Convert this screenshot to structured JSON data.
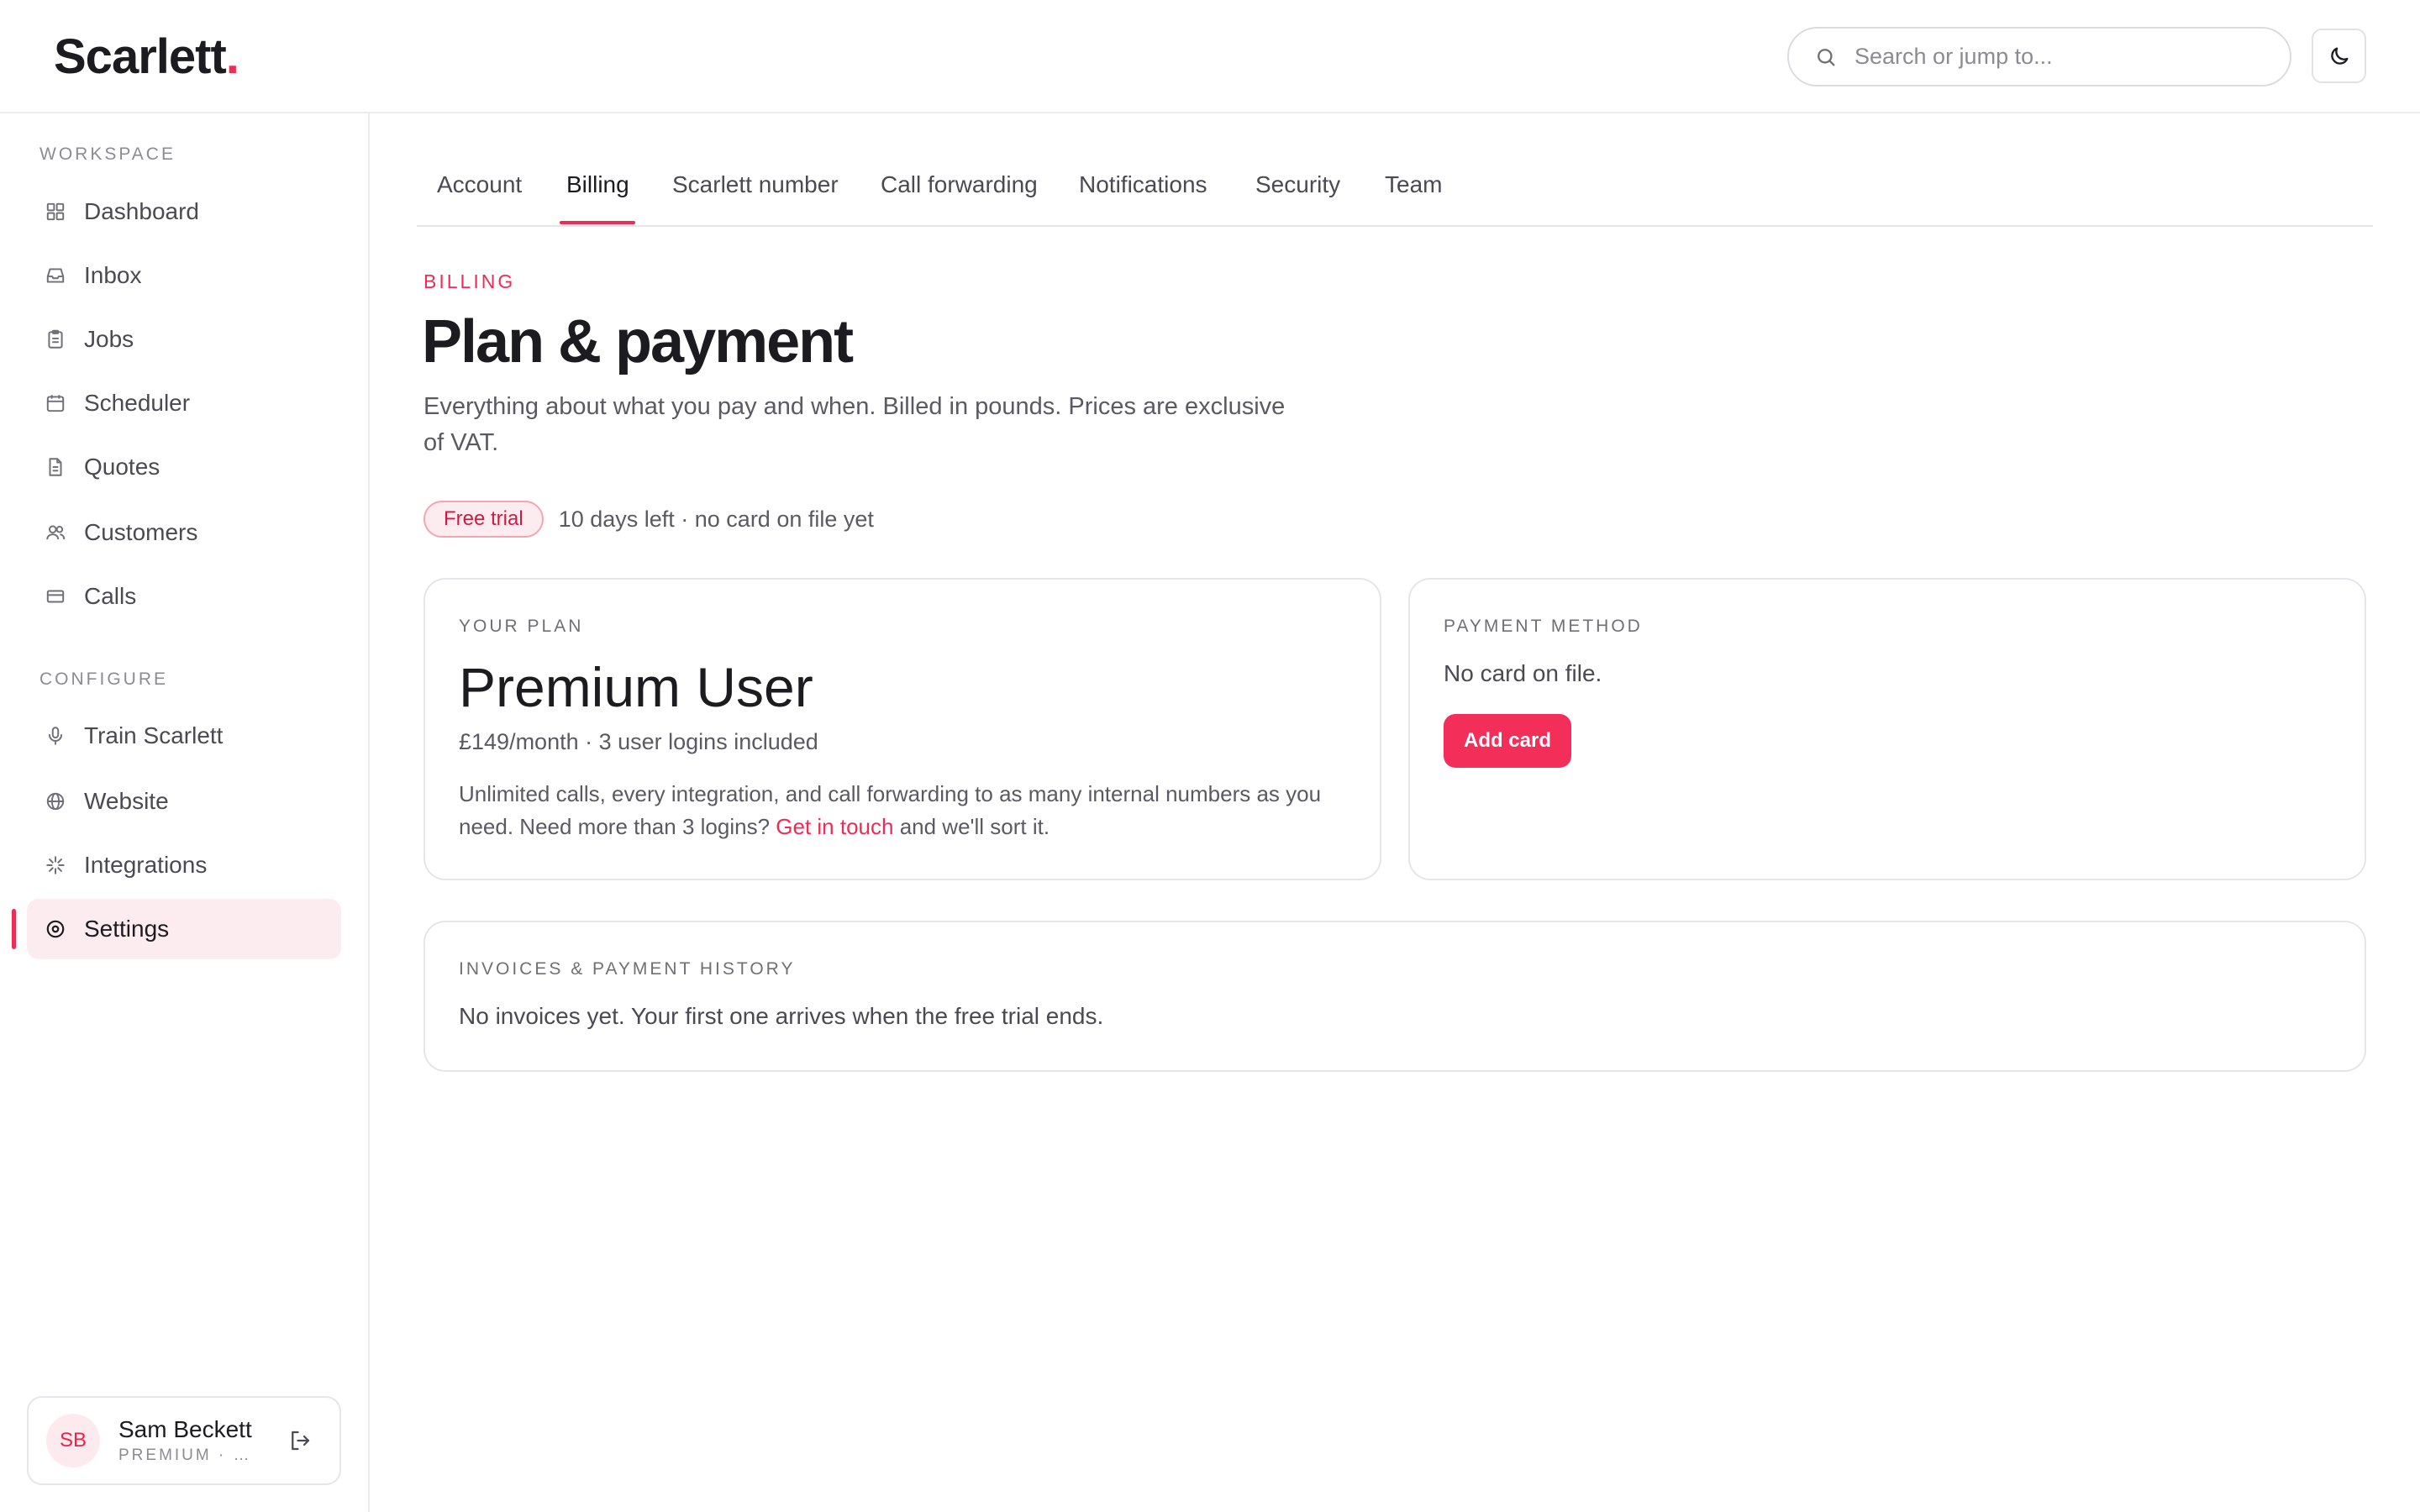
{
  "app": {
    "logo_text": "Scarlett",
    "logo_dot": ".",
    "brand_color": "#ee2c54"
  },
  "header": {
    "search_placeholder": "Search or jump to...",
    "search_icon": "search-icon",
    "theme_icon": "moon-icon"
  },
  "sidebar": {
    "workspace_label": "WORKSPACE",
    "workspace_items": [
      {
        "label": "Dashboard",
        "icon": "grid-icon"
      },
      {
        "label": "Inbox",
        "icon": "inbox-icon"
      },
      {
        "label": "Jobs",
        "icon": "clipboard-icon"
      },
      {
        "label": "Scheduler",
        "icon": "calendar-icon"
      },
      {
        "label": "Quotes",
        "icon": "document-icon"
      },
      {
        "label": "Customers",
        "icon": "users-icon"
      },
      {
        "label": "Calls",
        "icon": "card-icon"
      }
    ],
    "configure_label": "CONFIGURE",
    "configure_items": [
      {
        "label": "Train Scarlett",
        "icon": "microphone-icon"
      },
      {
        "label": "Website",
        "icon": "globe-icon"
      },
      {
        "label": "Integrations",
        "icon": "sparkle-icon"
      },
      {
        "label": "Settings",
        "icon": "settings-icon",
        "active": true
      }
    ],
    "user": {
      "initials": "SB",
      "name": "Sam Beckett",
      "plan": "PREMIUM · S..."
    }
  },
  "tabs": [
    {
      "label": "Account"
    },
    {
      "label": "Billing",
      "active": true
    },
    {
      "label": "Scarlett number"
    },
    {
      "label": "Call forwarding"
    },
    {
      "label": "Notifications"
    },
    {
      "label": "Security"
    },
    {
      "label": "Team"
    }
  ],
  "billing": {
    "eyebrow": "BILLING",
    "title": "Plan & payment",
    "description": "Everything about what you pay and when. Billed in pounds. Prices are exclusive of VAT.",
    "trial_badge": "Free trial",
    "trial_status": "10 days left · no card on file yet",
    "plan_card": {
      "label": "YOUR PLAN",
      "name": "Premium User",
      "price": "£149/month · 3 user logins included",
      "desc_before": "Unlimited calls, every integration, and call forwarding to as many internal numbers as you need. Need more than 3 logins? ",
      "desc_link": "Get in touch",
      "desc_after": " and we'll sort it."
    },
    "payment_card": {
      "label": "PAYMENT METHOD",
      "text": "No card on file.",
      "button": "Add card"
    },
    "invoices_card": {
      "label": "INVOICES & PAYMENT HISTORY",
      "text": "No invoices yet. Your first one arrives when the free trial ends."
    }
  }
}
